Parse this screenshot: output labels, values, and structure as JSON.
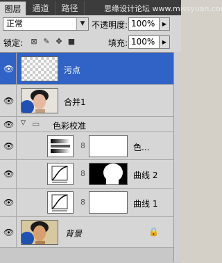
{
  "tabs": [
    {
      "label": "图层",
      "active": true
    },
    {
      "label": "通道",
      "active": false
    },
    {
      "label": "路径",
      "active": false
    }
  ],
  "watermark": "思缘设计论坛 www.missyuan.com",
  "blend_mode": "正常",
  "opacity": {
    "label": "不透明度:",
    "value": "100%"
  },
  "lock": {
    "label": "锁定:"
  },
  "fill": {
    "label": "填充:",
    "value": "100%"
  },
  "layers": [
    {
      "name": "污点",
      "type": "pixel-transparent",
      "selected": true
    },
    {
      "name": "合并1",
      "type": "photo"
    },
    {
      "name": "色彩校准",
      "type": "group"
    },
    {
      "name": "色...",
      "type": "adjustment-gradient",
      "indent": true
    },
    {
      "name": "曲线 2",
      "type": "adjustment-curves",
      "indent": true
    },
    {
      "name": "曲线 1",
      "type": "adjustment-curves",
      "indent": true
    },
    {
      "name": "背景",
      "type": "background",
      "locked": true
    }
  ],
  "colors": {
    "selected_row": "#3163c6",
    "tab_bar": "#3c3c3c",
    "panel": "#d6d6d6"
  }
}
